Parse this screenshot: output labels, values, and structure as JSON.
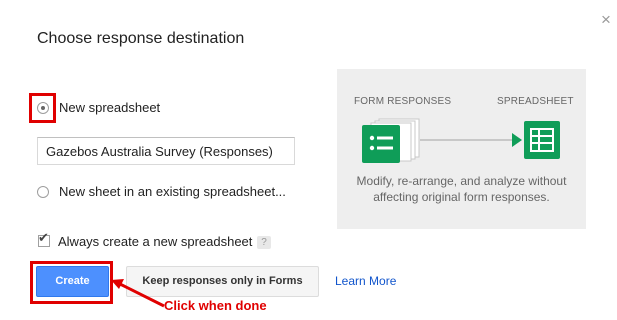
{
  "dialog": {
    "title": "Choose response destination",
    "close_glyph": "×"
  },
  "options": {
    "new_spreadsheet": {
      "label": "New spreadsheet",
      "selected": true
    },
    "spreadsheet_name": {
      "value": "Gazebos Australia Survey (Responses)"
    },
    "existing_sheet": {
      "label": "New sheet in an existing spreadsheet...",
      "selected": false
    }
  },
  "always_create": {
    "label": "Always create a new spreadsheet",
    "checked": true,
    "help_glyph": "?"
  },
  "buttons": {
    "create": "Create",
    "keep_in_forms": "Keep responses only in Forms",
    "learn_more": "Learn More"
  },
  "annotation": {
    "text": "Click when done",
    "color": "#e00000"
  },
  "illustration": {
    "left_label": "FORM RESPONSES",
    "right_label": "SPREADSHEET",
    "description_line1": "Modify, re-arrange, and analyze without",
    "description_line2": "affecting original form responses.",
    "icon_color": "#0f9d58",
    "left_icon": "form-responses-icon",
    "right_icon": "spreadsheet-icon"
  },
  "colors": {
    "primary": "#4d90fe",
    "link": "#1155cc",
    "highlight": "#e00000"
  }
}
